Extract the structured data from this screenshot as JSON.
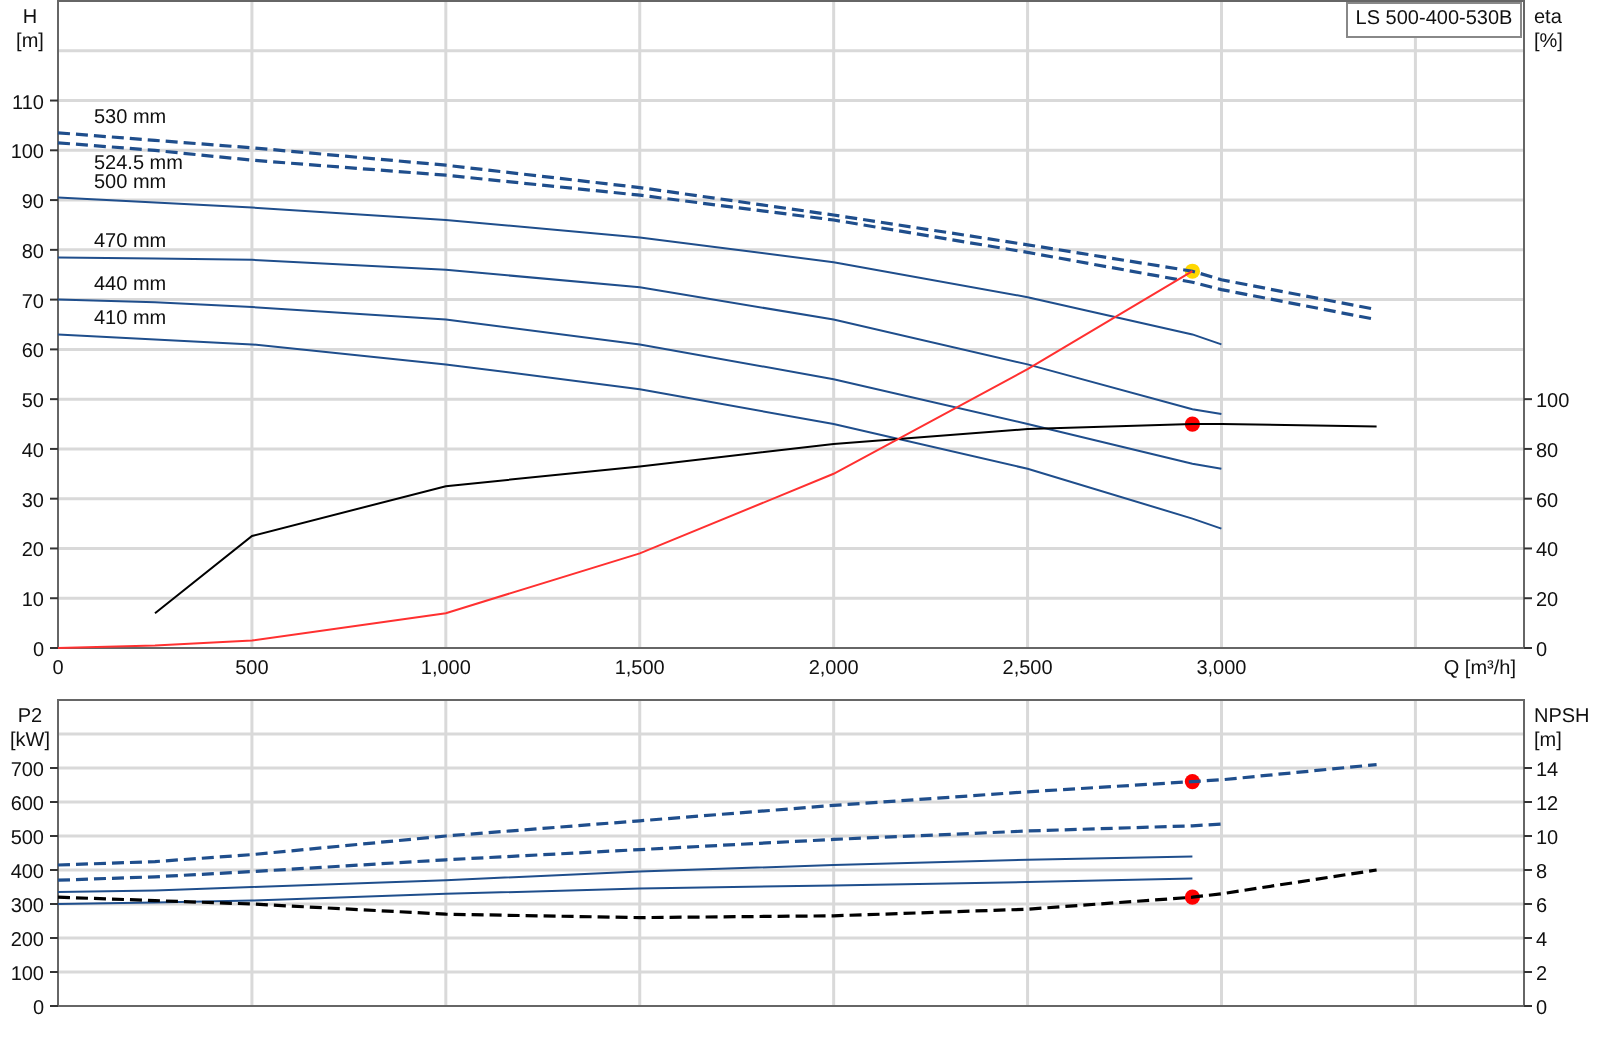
{
  "model_label": "LS 500-400-530B",
  "head_chart": {
    "y_unit": "[m]",
    "y2_unit": "[%]",
    "chart_data": {
      "type": "line",
      "xlabel": "Q [m³/h]",
      "ylabel": "H",
      "y2label": "eta",
      "x": [
        0,
        250,
        500,
        1000,
        1500,
        2000,
        2500,
        2925,
        3000,
        3400
      ],
      "xlim": [
        0,
        3780
      ],
      "ylim": [
        0,
        130
      ],
      "y2lim": [
        0,
        260
      ],
      "grid": true,
      "xticks": [
        {
          "value": 0,
          "label": "0"
        },
        {
          "value": 500,
          "label": "500"
        },
        {
          "value": 1000,
          "label": "1,000"
        },
        {
          "value": 1500,
          "label": "1,500"
        },
        {
          "value": 2000,
          "label": "2,000"
        },
        {
          "value": 2500,
          "label": "2,500"
        },
        {
          "value": 3000,
          "label": "3,000"
        }
      ],
      "yticks": [
        0,
        10,
        20,
        30,
        40,
        50,
        60,
        70,
        80,
        90,
        100,
        110
      ],
      "y2ticks": [
        0,
        20,
        40,
        60,
        80,
        100
      ],
      "series": [
        {
          "name": "530 mm",
          "color": "#1f4e8c",
          "line_style": "dashed",
          "values": [
            103.5,
            102,
            100.5,
            97,
            92.5,
            87,
            81,
            75.7,
            74,
            68
          ]
        },
        {
          "name": "524.5 mm",
          "color": "#1f4e8c",
          "line_style": "dashed",
          "values": [
            101.5,
            100,
            98,
            95,
            91,
            86,
            79.5,
            73.5,
            72,
            66
          ]
        },
        {
          "name": "500 mm",
          "color": "#1f4e8c",
          "values": [
            90.5,
            89.5,
            88.5,
            86,
            82.5,
            77.5,
            70.5,
            63,
            61,
            null
          ]
        },
        {
          "name": "470 mm",
          "color": "#1f4e8c",
          "values": [
            78.5,
            78.3,
            78,
            76,
            72.5,
            66,
            57,
            48,
            47,
            null
          ]
        },
        {
          "name": "440 mm",
          "color": "#1f4e8c",
          "values": [
            70,
            69.5,
            68.5,
            66,
            61,
            54,
            45,
            37,
            36,
            null
          ]
        },
        {
          "name": "410 mm",
          "color": "#1f4e8c",
          "values": [
            63,
            62,
            61,
            57,
            52,
            45,
            36,
            26,
            24,
            null
          ]
        },
        {
          "axis": "y2",
          "color": "#000000",
          "values": [
            null,
            14,
            45,
            65,
            73,
            82,
            88,
            90,
            90,
            89
          ]
        },
        {
          "color": "#ff3030",
          "values": [
            0,
            0.5,
            1.5,
            7,
            19,
            35,
            56,
            75.7,
            null,
            null
          ]
        },
        {
          "color": "#ffd700",
          "marker": "circle",
          "values": [
            null,
            null,
            null,
            null,
            null,
            null,
            null,
            75.7,
            null,
            null
          ]
        },
        {
          "axis": "y2",
          "color": "#ff0000",
          "marker": "circle",
          "values": [
            null,
            null,
            null,
            null,
            null,
            null,
            null,
            90,
            null,
            null
          ]
        }
      ]
    }
  },
  "power_chart": {
    "y_unit": "[kW]",
    "y2_unit": "[m]",
    "chart_data": {
      "type": "line",
      "ylabel": "P2",
      "y2label": "NPSH",
      "x": [
        0,
        250,
        500,
        1000,
        1500,
        2000,
        2500,
        2925,
        3000,
        3400
      ],
      "xlim": [
        0,
        3780
      ],
      "ylim": [
        0,
        900
      ],
      "y2lim": [
        0,
        18
      ],
      "grid": true,
      "yticks": [
        0,
        100,
        200,
        300,
        400,
        500,
        600,
        700
      ],
      "y2ticks": [
        0,
        2,
        4,
        6,
        8,
        10,
        12,
        14
      ],
      "series": [
        {
          "color": "#1f4e8c",
          "line_style": "dashed",
          "values": [
            415,
            425,
            445,
            500,
            545,
            590,
            630,
            660,
            665,
            710
          ]
        },
        {
          "color": "#1f4e8c",
          "line_style": "dashed",
          "values": [
            370,
            380,
            395,
            430,
            460,
            490,
            515,
            530,
            535,
            null
          ]
        },
        {
          "color": "#1f4e8c",
          "values": [
            335,
            340,
            350,
            370,
            395,
            415,
            430,
            440,
            null,
            null
          ]
        },
        {
          "color": "#1f4e8c",
          "values": [
            300,
            305,
            310,
            330,
            345,
            355,
            365,
            375,
            null,
            null
          ]
        },
        {
          "axis": "y2",
          "color": "#000000",
          "line_style": "dashed",
          "values": [
            6.4,
            6.2,
            6,
            5.4,
            5.2,
            5.3,
            5.7,
            6.4,
            6.6,
            8
          ]
        },
        {
          "color": "#ff0000",
          "marker": "circle",
          "values": [
            null,
            null,
            null,
            null,
            null,
            null,
            null,
            660,
            null,
            null
          ]
        },
        {
          "axis": "y2",
          "color": "#ff0000",
          "marker": "circle",
          "values": [
            null,
            null,
            null,
            null,
            null,
            null,
            null,
            6.4,
            null,
            null
          ]
        }
      ]
    }
  }
}
